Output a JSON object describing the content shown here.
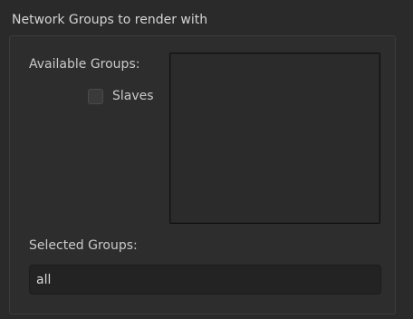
{
  "panel": {
    "title": "Network Groups to render with"
  },
  "available_groups": {
    "label": "Available Groups:",
    "items": []
  },
  "slaves_checkbox": {
    "label": "Slaves",
    "checked": false
  },
  "selected_groups": {
    "label": "Selected Groups:",
    "value": "all"
  }
}
